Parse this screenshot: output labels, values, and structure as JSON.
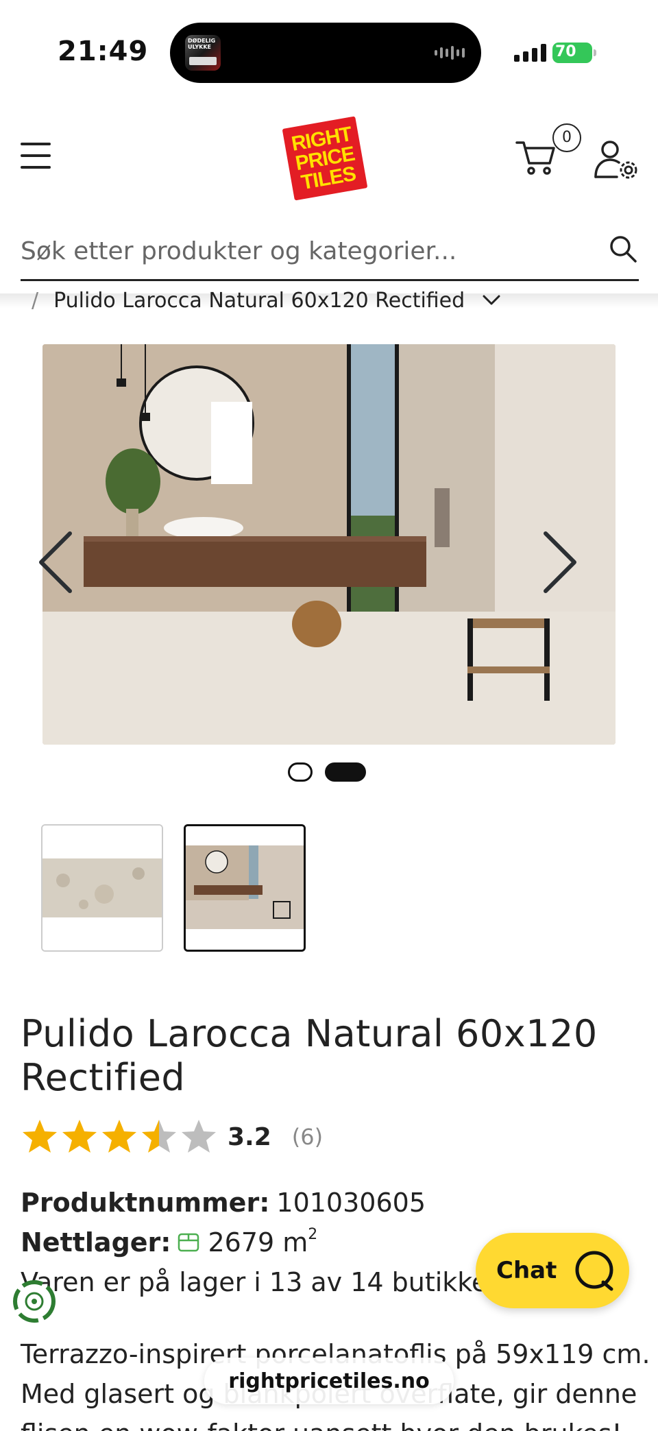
{
  "status_bar": {
    "time": "21:49",
    "battery": "70",
    "now_playing_art_text": "DØDELIG ULYKKE"
  },
  "header": {
    "logo_lines": [
      "RIGHT",
      "PRICE",
      "TILES"
    ],
    "cart_count": "0",
    "brand_colors": {
      "logo_red": "#e31d24",
      "logo_yellow": "#ffe100"
    }
  },
  "search": {
    "placeholder": "Søk etter produkter og kategorier..."
  },
  "breadcrumb": {
    "separator": "/",
    "current": "Pulido Larocca Natural 60x120 Rectified"
  },
  "gallery": {
    "slides": 2,
    "active_slide": 2
  },
  "product": {
    "title": "Pulido Larocca Natural 60x120 Rectified",
    "rating_value": "3.2",
    "rating_count": "(6)",
    "stars_filled": 3.5,
    "sku_label": "Produktnummer:",
    "sku_value": "101030605",
    "stock_label": "Nettlager:",
    "stock_value": "2679 m",
    "stock_unit_sup": "2",
    "store_stock": "Varen er på lager i 13 av 14 butikker",
    "description": "Terrazzo-inspirert porcelanatoflis på 59x119 cm. Med glasert og blankpolert overflate, gir denne flisen en wow-faktor uansett hvor den brukes!"
  },
  "chat": {
    "label": "Chat",
    "accent": "#ffd931"
  },
  "browser": {
    "url": "rightpricetiles.no"
  },
  "colors": {
    "star": "#f5b000",
    "star_empty": "#bdbdbd",
    "stock_green": "#4caf50"
  }
}
